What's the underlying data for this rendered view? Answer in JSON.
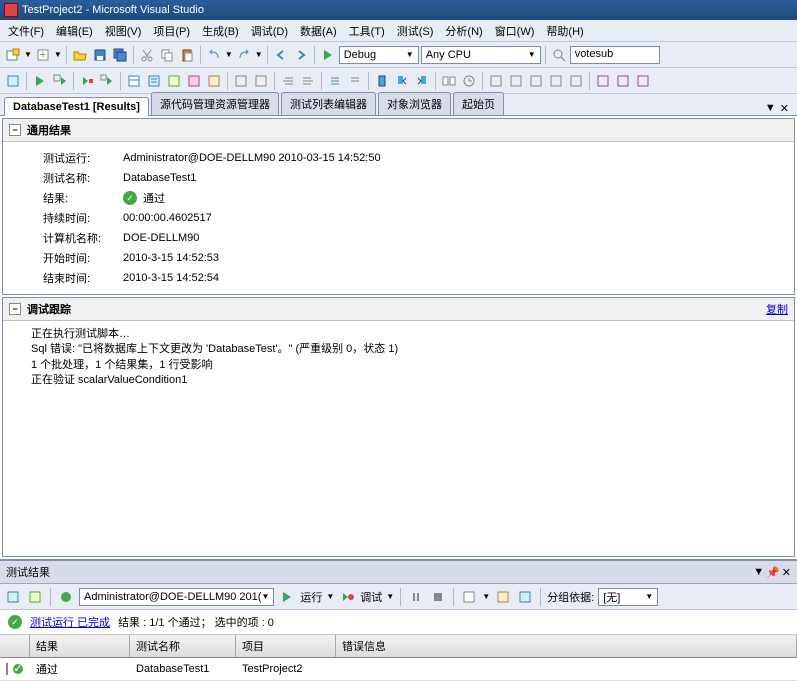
{
  "titlebar": "TestProject2 - Microsoft Visual Studio",
  "menu": {
    "file": "文件(F)",
    "edit": "编辑(E)",
    "view": "视图(V)",
    "project": "项目(P)",
    "build": "生成(B)",
    "debug": "调试(D)",
    "data": "数据(A)",
    "tools": "工具(T)",
    "test": "测试(S)",
    "analyze": "分析(N)",
    "window": "窗口(W)",
    "help": "帮助(H)"
  },
  "toolbar_config": "Debug",
  "toolbar_platform": "Any CPU",
  "toolbar_find": "votesub",
  "tabs": {
    "active": "DatabaseTest1 [Results]",
    "t1": "源代码管理资源管理器",
    "t2": "测试列表编辑器",
    "t3": "对象浏览器",
    "t4": "起始页"
  },
  "general_results": {
    "header": "通用结果",
    "labels": {
      "run": "测试运行:",
      "name": "测试名称:",
      "result": "结果:",
      "duration": "持续时间:",
      "computer": "计算机名称:",
      "start": "开始时间:",
      "end": "结束时间:"
    },
    "values": {
      "run": "Administrator@DOE-DELLM90 2010-03-15 14:52:50",
      "name": "DatabaseTest1",
      "result": "通过",
      "duration": "00:00:00.4602517",
      "computer": "DOE-DELLM90",
      "start": "2010-3-15 14:52:53",
      "end": "2010-3-15 14:52:54"
    }
  },
  "debug_trace": {
    "header": "调试跟踪",
    "copy": "复制",
    "lines": {
      "l1": "正在执行测试脚本…",
      "l2": "Sql 错误:  \"已将数据库上下文更改为 'DatabaseTest'。\" (严重级别 0，状态 1)",
      "l3": "1 个批处理，1 个结果集，1 行受影响",
      "l4": "正在验证 scalarValueCondition1"
    }
  },
  "test_results": {
    "panel_title": "测试结果",
    "run_context": "Administrator@DOE-DELLM90 201(",
    "run_btn": "运行",
    "debug_btn": "调试",
    "group_by_label": "分组依据:",
    "group_by_value": "[无]",
    "status_link": "测试运行 已完成",
    "status_text": "结果 : 1/1 个通过； 选中的项 : 0",
    "columns": {
      "result": "结果",
      "name": "测试名称",
      "project": "项目",
      "error": "错误信息"
    },
    "row": {
      "result": "通过",
      "name": "DatabaseTest1",
      "project": "TestProject2",
      "error": ""
    }
  }
}
